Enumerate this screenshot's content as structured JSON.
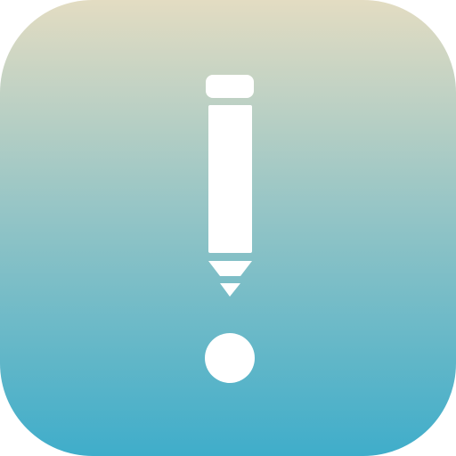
{
  "app_icon": {
    "icon": "pencil-exclamation-icon",
    "colors": {
      "gradient_top": "#e3dcc2",
      "gradient_mid": "#8fc3c6",
      "gradient_bottom": "#3fadca",
      "glyph": "#ffffff"
    }
  }
}
